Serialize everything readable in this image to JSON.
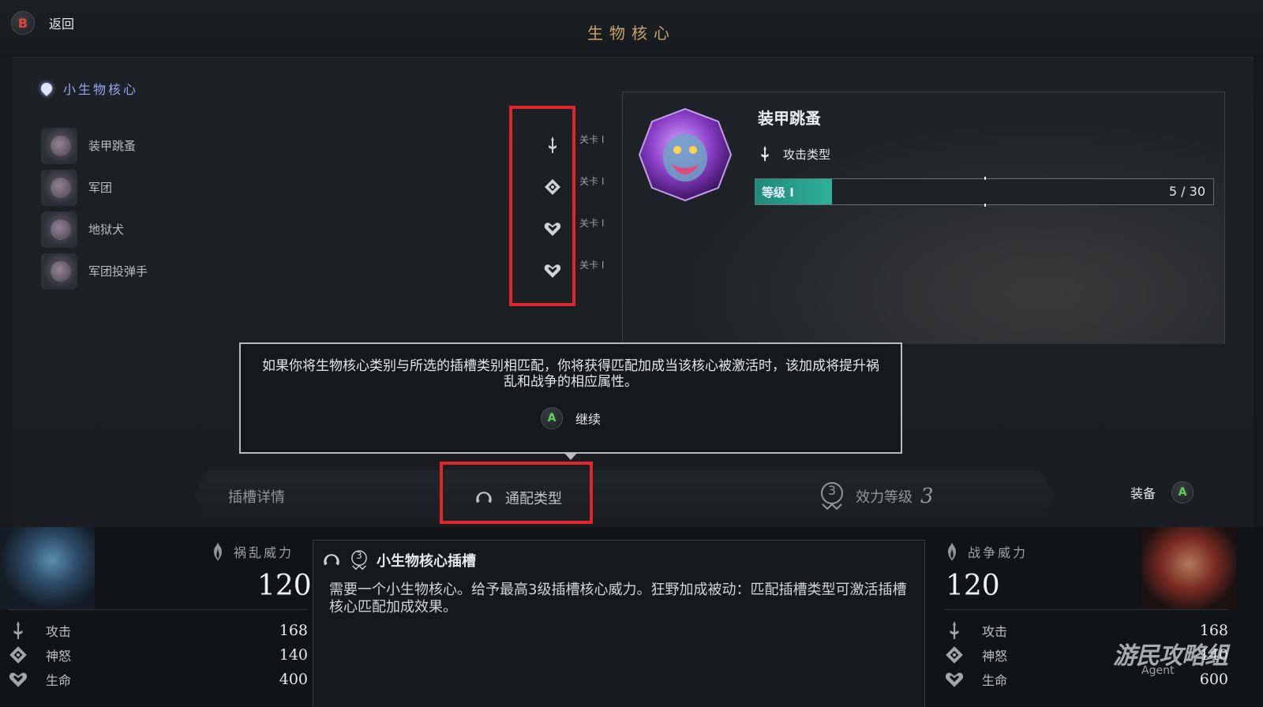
{
  "header": {
    "back_button_glyph": "B",
    "back_label": "返回",
    "title": "生物核心"
  },
  "category": {
    "label": "小生物核心",
    "icon": "gem-icon"
  },
  "cores": [
    {
      "name": "装甲跳蚤",
      "slot_icon": "sword-icon",
      "slot_text": "关卡 I"
    },
    {
      "name": "军团",
      "slot_icon": "diamond-icon",
      "slot_text": "关卡 I"
    },
    {
      "name": "地狱犬",
      "slot_icon": "heart-icon",
      "slot_text": "关卡 I"
    },
    {
      "name": "军团投弹手",
      "slot_icon": "heart-icon",
      "slot_text": "关卡 I"
    }
  ],
  "detail": {
    "title": "装甲跳蚤",
    "type_label": "攻击类型",
    "type_icon": "sword-icon",
    "level_label": "等级 I",
    "level_value": "5 / 30",
    "level_fraction": 0.1667
  },
  "dialog": {
    "text": "如果你将生物核心类别与所选的插槽类别相匹配，你将获得匹配加成当该核心被激活时，该加成将提升祸乱和战争的相应属性。",
    "continue_glyph": "A",
    "continue_label": "继续"
  },
  "tabs": {
    "details_label": "插槽详情",
    "match_label": "通配类型",
    "power_label": "效力等级",
    "power_value": "3",
    "power_badge": "3",
    "equip_label": "装备",
    "equip_glyph": "A"
  },
  "left_stats": {
    "title": "祸乱威力",
    "power": "120",
    "rows": [
      {
        "name": "攻击",
        "value": "168"
      },
      {
        "name": "神怒",
        "value": "140"
      },
      {
        "name": "生命",
        "value": "400"
      }
    ]
  },
  "slot_info": {
    "badge": "3",
    "title": "小生物核心插槽",
    "desc": "需要一个小生物核心。给予最高3级插槽核心威力。狂野加成被动：匹配插槽类型可激活插槽核心匹配加成效果。"
  },
  "right_stats": {
    "title": "战争威力",
    "power": "120",
    "rows": [
      {
        "name": "攻击",
        "value": "168"
      },
      {
        "name": "神怒",
        "value": "140"
      },
      {
        "name": "生命",
        "value": "600"
      }
    ]
  },
  "watermark": {
    "line1": "游民攻略组",
    "line2": "Agent"
  },
  "colors": {
    "accent_gold": "#c8a46a",
    "highlight_red": "#e0262a",
    "level_teal": "#2fb09b",
    "button_a": "#5fd15a",
    "button_b": "#e0453a"
  }
}
